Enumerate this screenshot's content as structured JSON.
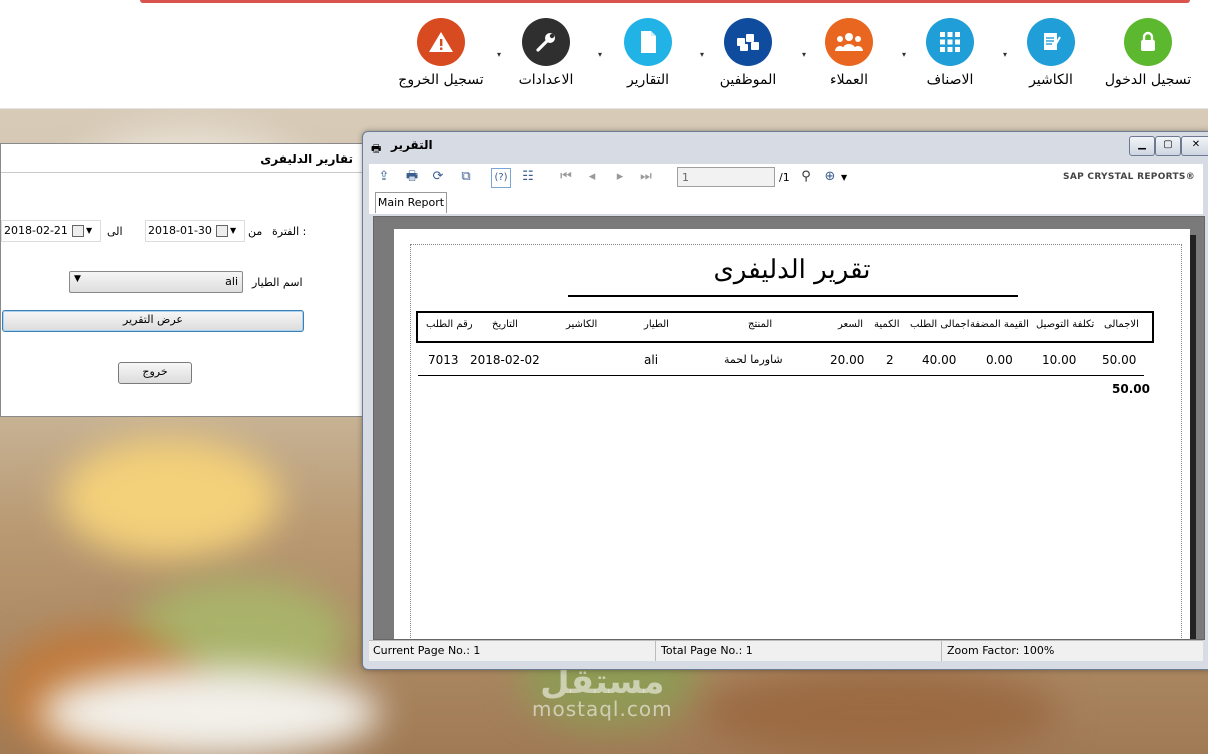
{
  "ribbon": {
    "items": [
      {
        "label": "تسجيل الدخول",
        "icon": "lock-icon",
        "color": "#5cb82e"
      },
      {
        "label": "الكاشير",
        "icon": "document-pen-icon",
        "color": "#1f9ed7"
      },
      {
        "label": "الاصناف",
        "icon": "grid-icon",
        "color": "#1f9ed7"
      },
      {
        "label": "العملاء",
        "icon": "users-group-icon",
        "color": "#e8661f"
      },
      {
        "label": "الموظفين",
        "icon": "employees-icon",
        "color": "#0f4c9e"
      },
      {
        "label": "التقارير",
        "icon": "report-icon",
        "color": "#22b3e6"
      },
      {
        "label": "الاعدادات",
        "icon": "wrench-icon",
        "color": "#2f2f2f"
      },
      {
        "label": "تسجيل الخروج",
        "icon": "warning-icon",
        "color": "#d84a1f"
      }
    ]
  },
  "left_form": {
    "title": "تقارير الدليفرى",
    "period_label": "الفترة :",
    "from_label": "من",
    "from_date": "2018-01-30",
    "to_label": "الى",
    "to_date": "2018-02-21",
    "courier_label": "اسم الطيار",
    "courier_value": "ali",
    "show_report_button": "عرض التقرير",
    "exit_button": "خروج"
  },
  "report_window": {
    "title": "التقرير",
    "page_input": "1",
    "page_total": "/1",
    "brand": "SAP CRYSTAL REPORTS®",
    "tab": "Main Report",
    "status": {
      "current_page": "Current Page No.: 1",
      "total_page": "Total Page No.: 1",
      "zoom": "Zoom Factor: 100%"
    }
  },
  "report": {
    "heading": "تقرير الدليفرى",
    "columns": {
      "total": "الاجمالى",
      "delivery_cost": "تكلفة التوصيل",
      "vat": "القيمة المضفة",
      "order_total": "اجمالى الطلب",
      "qty": "الكمية",
      "price": "السعر",
      "product": "المنتج",
      "courier": "الطيار",
      "cashier": "الكاشير",
      "date": "التاريخ",
      "order_no": "رقم الطلب"
    },
    "row": {
      "total": "50.00",
      "delivery_cost": "10.00",
      "vat": "0.00",
      "order_total": "40.00",
      "qty": "2",
      "price": "20.00",
      "product": "شاورما لحمة",
      "courier": "ali",
      "cashier": "",
      "date": "2018-02-02",
      "order_no": "7013"
    },
    "grand_total": "50.00"
  },
  "watermark": {
    "line1": "مستقل",
    "line2": "mostaql.com"
  }
}
